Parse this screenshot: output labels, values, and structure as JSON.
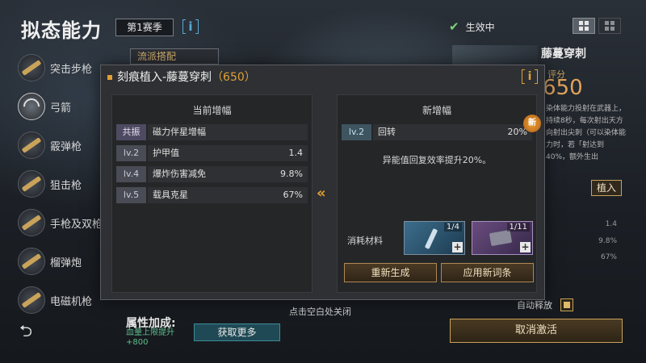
{
  "header": {
    "title": "拟态能力",
    "season": "第1赛季",
    "info_label": "i",
    "status_label": "生效中"
  },
  "sidebar": {
    "items": [
      {
        "label": "突击步枪"
      },
      {
        "label": "弓箭"
      },
      {
        "label": "霰弹枪"
      },
      {
        "label": "狙击枪"
      },
      {
        "label": "手枪及双枪"
      },
      {
        "label": "榴弹炮"
      },
      {
        "label": "电磁机枪"
      }
    ]
  },
  "style_match": "流派搭配",
  "attribute_bonus": {
    "title": "属性加成:",
    "desc": "血量上限提升\n+800",
    "get_more": "获取更多"
  },
  "close_hint": "点击空白处关闭",
  "right_panel": {
    "title": "藤蔓穿刺",
    "score_label": "评分",
    "score": "650",
    "desc": "染体能力投射在武器上，持续8秒，每次射出天方向射出尖刺（可以染体能力时，若「射达到40%，额外生出",
    "inlay_button": "植入",
    "stats": [
      "1.4",
      "9.8%",
      "67%"
    ],
    "auto_release": "自动释放",
    "cancel_button": "取消激活"
  },
  "modal": {
    "title": "刻痕植入-藤蔓穿刺",
    "score": "（650）",
    "info_label": "i",
    "current": {
      "heading": "当前增幅",
      "rows": [
        {
          "tag": "共振",
          "name": "磁力伴星增幅",
          "value": ""
        },
        {
          "tag": "lv.2",
          "name": "护甲值",
          "value": "1.4"
        },
        {
          "tag": "lv.4",
          "name": "爆炸伤害减免",
          "value": "9.8%"
        },
        {
          "tag": "lv.5",
          "name": "载具克星",
          "value": "67%"
        }
      ]
    },
    "arrow": "«",
    "new": {
      "heading": "新增幅",
      "badge": "新",
      "row": {
        "tag": "lv.2",
        "name": "回转",
        "value": "20%"
      },
      "effect": "异能值回复效率提升20%。",
      "consume_label": "消耗材料",
      "materials": [
        {
          "count": "1/4",
          "color": "blue"
        },
        {
          "count": "1/11",
          "color": "purple"
        }
      ],
      "plus": "+",
      "regen_button": "重新生成",
      "apply_button": "应用新词条"
    }
  }
}
